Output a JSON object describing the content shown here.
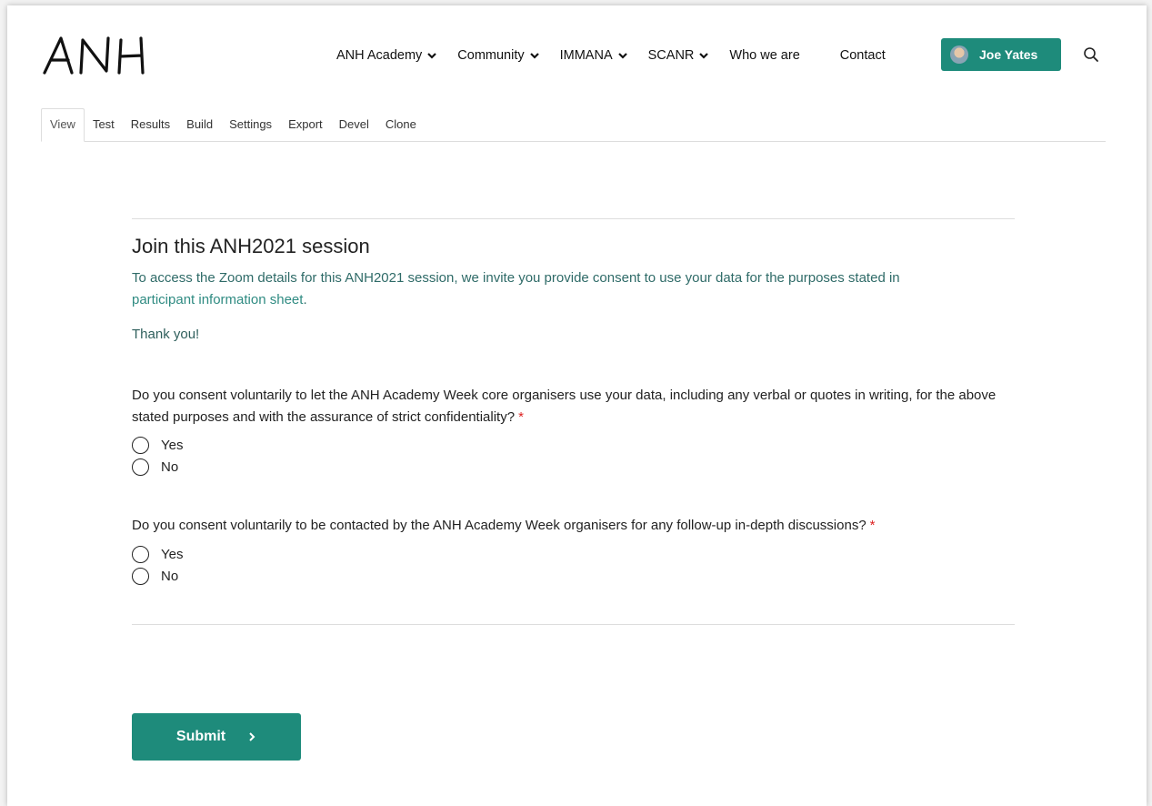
{
  "brand": {
    "logo_text": "ANH",
    "accent_color": "#1e8b7b"
  },
  "nav": {
    "items": [
      {
        "label": "ANH Academy",
        "has_dropdown": true
      },
      {
        "label": "Community",
        "has_dropdown": true
      },
      {
        "label": "IMMANA",
        "has_dropdown": true
      },
      {
        "label": "SCANR",
        "has_dropdown": true
      },
      {
        "label": "Who we are",
        "has_dropdown": false
      },
      {
        "label": "Contact",
        "has_dropdown": false
      }
    ],
    "user_name": "Joe Yates",
    "search_icon": "search-icon"
  },
  "tabs": [
    {
      "label": "View",
      "active": true
    },
    {
      "label": "Test"
    },
    {
      "label": "Results"
    },
    {
      "label": "Build"
    },
    {
      "label": "Settings"
    },
    {
      "label": "Export"
    },
    {
      "label": "Devel"
    },
    {
      "label": "Clone"
    }
  ],
  "form": {
    "title": "Join this ANH2021 session",
    "intro_text": "To access the Zoom details for this ANH2021 session, we invite you provide consent to use your data for the purposes stated in",
    "intro_link": "participant information sheet",
    "intro_end": ".",
    "thanks": "Thank you!",
    "required_marker": "*",
    "questions": [
      {
        "text": "Do you consent voluntarily to let the ANH Academy Week core organisers use your data, including any verbal or quotes in writing, for the above stated purposes and with the assurance of strict confidentiality?",
        "options": [
          "Yes",
          "No"
        ]
      },
      {
        "text": "Do you consent voluntarily to be contacted by the ANH Academy Week organisers for any follow-up in-depth discussions?",
        "options": [
          "Yes",
          "No"
        ]
      }
    ],
    "submit_label": "Submit"
  }
}
